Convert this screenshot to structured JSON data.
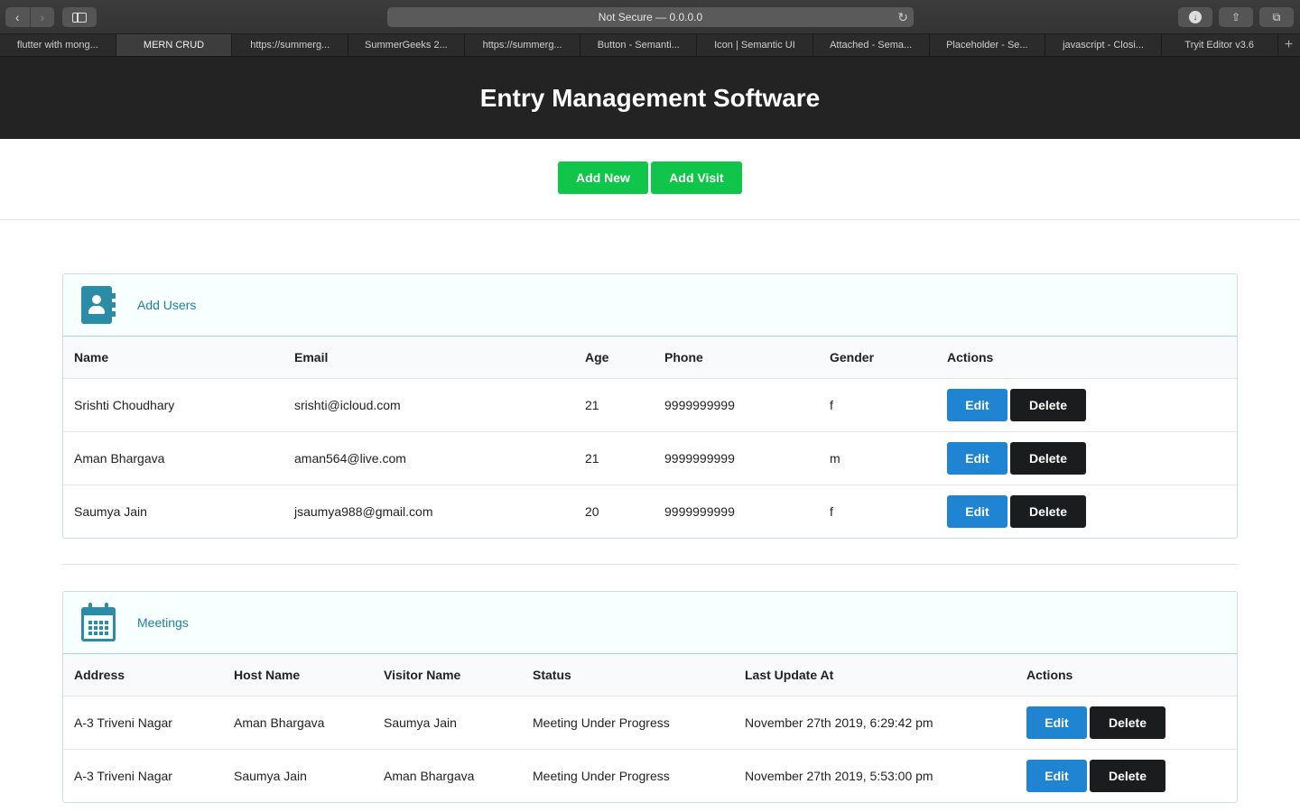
{
  "browser": {
    "address": "Not Secure — 0.0.0.0",
    "tabs": [
      {
        "label": "flutter with mong...",
        "active": false
      },
      {
        "label": "MERN CRUD",
        "active": true
      },
      {
        "label": "https://summerg...",
        "active": false
      },
      {
        "label": "SummerGeeks 2...",
        "active": false
      },
      {
        "label": "https://summerg...",
        "active": false
      },
      {
        "label": "Button - Semanti...",
        "active": false
      },
      {
        "label": "Icon | Semantic UI",
        "active": false
      },
      {
        "label": "Attached - Sema...",
        "active": false
      },
      {
        "label": "Placeholder - Se...",
        "active": false
      },
      {
        "label": "javascript - Closi...",
        "active": false
      },
      {
        "label": "Tryit Editor v3.6",
        "active": false
      }
    ]
  },
  "header": {
    "title": "Entry Management Software"
  },
  "actions": {
    "add_new": "Add New",
    "add_visit": "Add Visit"
  },
  "users": {
    "title": "Add Users",
    "columns": [
      "Name",
      "Email",
      "Age",
      "Phone",
      "Gender",
      "Actions"
    ],
    "rows": [
      {
        "name": "Srishti Choudhary",
        "email": "srishti@icloud.com",
        "age": "21",
        "phone": "9999999999",
        "gender": "f"
      },
      {
        "name": "Aman Bhargava",
        "email": "aman564@live.com",
        "age": "21",
        "phone": "9999999999",
        "gender": "m"
      },
      {
        "name": "Saumya Jain",
        "email": "jsaumya988@gmail.com",
        "age": "20",
        "phone": "9999999999",
        "gender": "f"
      }
    ]
  },
  "meetings": {
    "title": "Meetings",
    "columns": [
      "Address",
      "Host Name",
      "Visitor Name",
      "Status",
      "Last Update At",
      "Actions"
    ],
    "rows": [
      {
        "address": "A-3 Triveni Nagar",
        "host": "Aman Bhargava",
        "visitor": "Saumya Jain",
        "status": "Meeting Under Progress",
        "updated": "November 27th 2019, 6:29:42 pm"
      },
      {
        "address": "A-3 Triveni Nagar",
        "host": "Saumya Jain",
        "visitor": "Aman Bhargava",
        "status": "Meeting Under Progress",
        "updated": "November 27th 2019, 5:53:00 pm"
      }
    ]
  },
  "row_actions": {
    "edit": "Edit",
    "delete": "Delete"
  },
  "colors": {
    "green": "#0fc64a",
    "blue": "#1f84d2",
    "dark": "#1b1c1d",
    "teal": "#2a8da5"
  }
}
